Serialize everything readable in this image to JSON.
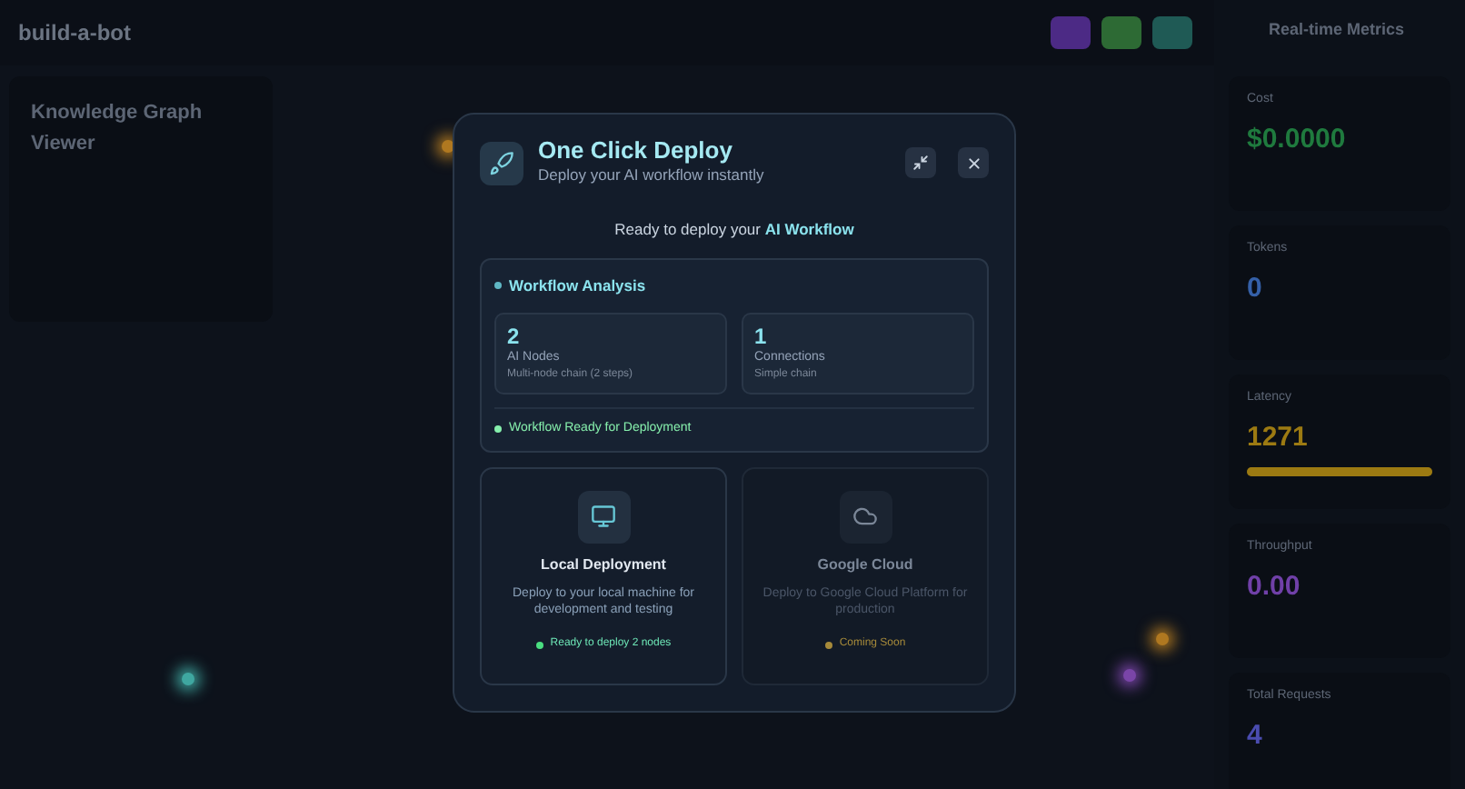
{
  "app": {
    "title": "build-a-bot"
  },
  "toolbar_buttons": [
    {
      "color": "#4c2a85"
    },
    {
      "color": "#2d6a34"
    },
    {
      "color": "#1f5a55"
    }
  ],
  "graph_panel": {
    "title": "Knowledge Graph Viewer"
  },
  "metrics_panel": {
    "title": "Real-time Metrics"
  },
  "metrics": [
    {
      "label": "Cost",
      "value": "$0.0000",
      "color": "#1f7a3e"
    },
    {
      "label": "Tokens",
      "value": "0",
      "color": "#3560a8"
    },
    {
      "label": "Latency",
      "value": "1271",
      "color": "#9c7a12",
      "level": 1
    },
    {
      "label": "Throughput",
      "value": "0.00",
      "color": "#7040a8"
    },
    {
      "label": "Total Requests",
      "value": "4",
      "color": "#4a4cb0"
    }
  ],
  "canvas_nodes": [
    {
      "color": "#b07820"
    },
    {
      "color": "#3fa7a0"
    },
    {
      "color": "#b07820"
    },
    {
      "color": "#7a45a8"
    }
  ],
  "modal": {
    "title": "One Click Deploy",
    "subtitle": "Deploy your AI workflow instantly",
    "intro": "Ready to deploy your **AI Workflow**",
    "analysis": {
      "title": "Workflow Analysis",
      "stats": [
        {
          "value": "2",
          "label": "AI Nodes",
          "note": "Multi-node chain (2 steps)"
        },
        {
          "value": "1",
          "label": "Connections",
          "note": "Simple chain"
        }
      ],
      "status": "Workflow Ready for Deployment"
    },
    "targets": [
      {
        "kind": "local",
        "title": "Local Deployment",
        "description": "Deploy to your local machine for development and testing",
        "status": "Ready to deploy 2 nodes",
        "disabled": false
      },
      {
        "kind": "cloud",
        "title": "Google Cloud",
        "description": "Deploy to Google Cloud Platform for production",
        "status": "Coming Soon",
        "disabled": true
      }
    ]
  }
}
